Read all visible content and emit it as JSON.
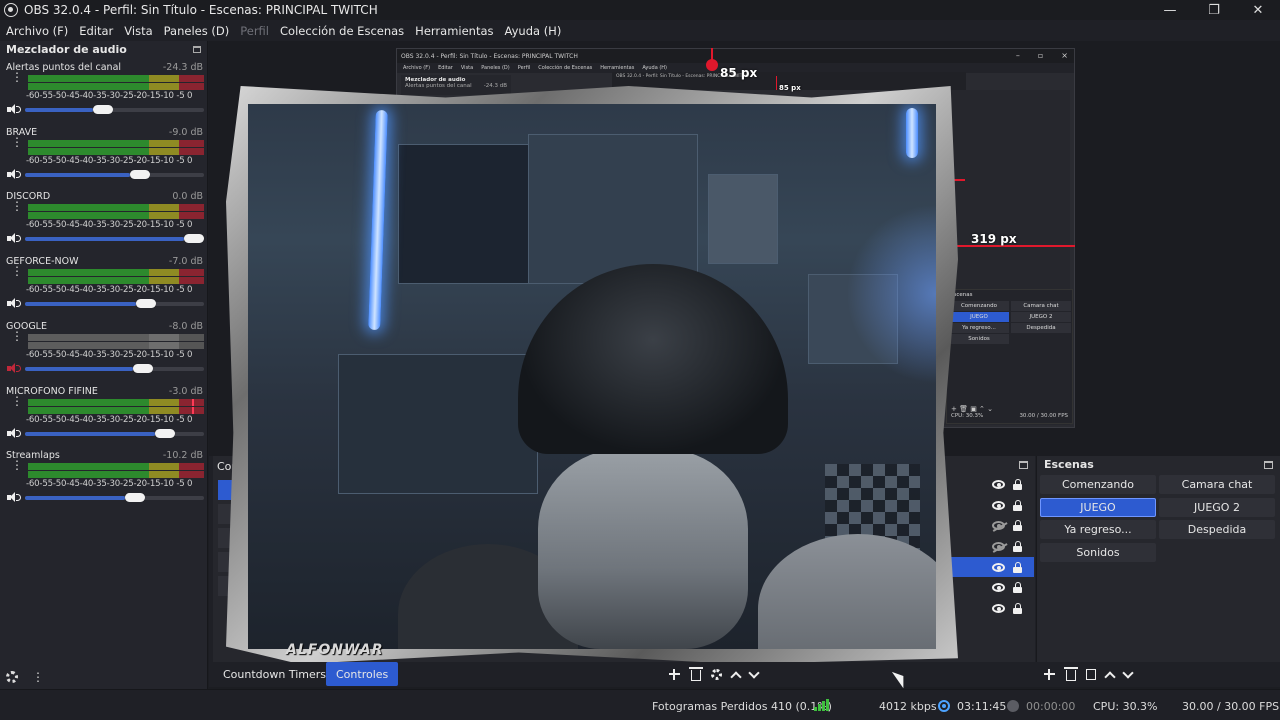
{
  "window": {
    "title": "OBS 32.0.4 - Perfil: Sin Título - Escenas: PRINCIPAL TWITCH",
    "controls": [
      "—",
      "❐",
      "✕"
    ]
  },
  "menu": [
    "Archivo (F)",
    "Editar",
    "Vista",
    "Paneles (D)",
    "Perfil",
    "Colección de Escenas",
    "Herramientas",
    "Ayuda (H)"
  ],
  "mixer": {
    "title": "Mezclador de audio",
    "scale": "-60-55-50-45-40-35-30-25-20-15-10 -5  0",
    "channels": [
      {
        "name": "Alertas puntos del canal",
        "db": "-24.3 dB",
        "level": 0.43,
        "muted": false
      },
      {
        "name": "BRAVE",
        "db": "-9.0 dB",
        "level": 0.66,
        "muted": false
      },
      {
        "name": "DISCORD",
        "db": "0.0 dB",
        "level": 1.0,
        "muted": false
      },
      {
        "name": "GEFORCE-NOW",
        "db": "-7.0 dB",
        "level": 0.7,
        "muted": false
      },
      {
        "name": "GOOGLE",
        "db": "-8.0 dB",
        "level": 0.68,
        "muted": true
      },
      {
        "name": "MICROFONO FIFINE",
        "db": "-3.0 dB",
        "level": 0.82,
        "muted": false
      },
      {
        "name": "Streamlaps",
        "db": "-10.2 dB",
        "level": 0.63,
        "muted": false
      }
    ]
  },
  "preview": {
    "guide_top_label": "85 px",
    "guide_top_label_small": "85 px",
    "guide_right_label": "319 px",
    "webcam_watermark": "ALFONWAR",
    "nested": {
      "title": "OBS 32.0.4 - Perfil: Sin Título - Escenas: PRINCIPAL TWITCH",
      "menu": [
        "Archivo (F)",
        "Editar",
        "Vista",
        "Paneles (D)",
        "Perfil",
        "Colección de Escenas",
        "Herramientas",
        "Ayuda (H)"
      ],
      "mixer_title": "Mezclador de audio",
      "mixer_channel": "Alertas puntos del canal",
      "mixer_db": "-24.3 dB",
      "scenes_title": "Escenas",
      "scenes": [
        "Comenzando",
        "Camara chat",
        "JUEGO",
        "JUEGO 2",
        "Ya regreso...",
        "Despedida",
        "Sonidos"
      ],
      "cpu": "CPU: 30.3%",
      "fps": "30.00 / 30.00 FPS"
    }
  },
  "sources_dock": {
    "title": "Con"
  },
  "scenes": {
    "title": "Escenas",
    "items": [
      "Comenzando",
      "Camara chat",
      "JUEGO",
      "JUEGO 2",
      "Ya regreso...",
      "Despedida",
      "Sonidos"
    ],
    "active": "JUEGO"
  },
  "dock_tabs": [
    "Countdown Timers",
    "Controles"
  ],
  "status": {
    "dropped_frames": "Fotogramas Perdidos 410 (0.1%)",
    "bitrate": "4012 kbps",
    "stream_time": "03:11:45",
    "rec_time": "00:00:00",
    "cpu": "CPU: 30.3%",
    "fps": "30.00 / 30.00 FPS"
  },
  "colors": {
    "accent": "#2d5bd0",
    "guide": "#e0182c",
    "meter_green": "#2d8a2d",
    "meter_yellow": "#8f8b23",
    "meter_red": "#8a2430"
  }
}
